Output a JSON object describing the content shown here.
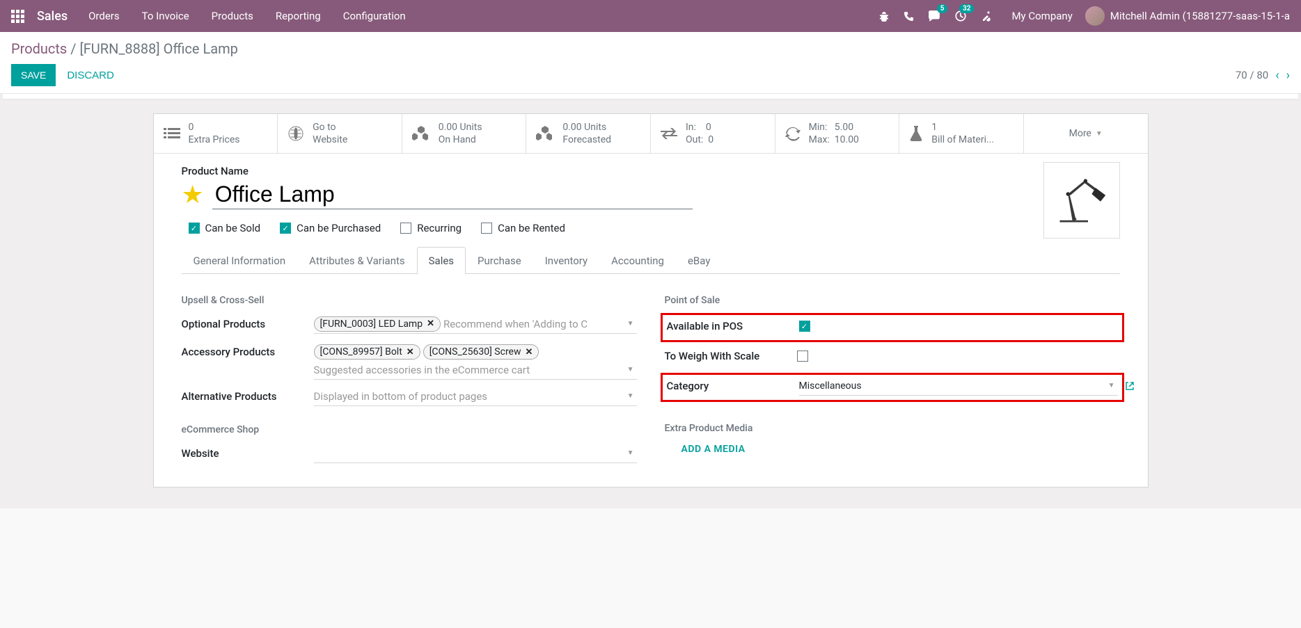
{
  "topbar": {
    "brand": "Sales",
    "nav": [
      "Orders",
      "To Invoice",
      "Products",
      "Reporting",
      "Configuration"
    ],
    "badge_chat": "5",
    "badge_clock": "32",
    "company": "My Company",
    "user": "Mitchell Admin (15881277-saas-15-1-a"
  },
  "breadcrumb": {
    "root": "Products",
    "current": "[FURN_8888] Office Lamp"
  },
  "actions": {
    "save": "SAVE",
    "discard": "DISCARD",
    "pager": "70 / 80"
  },
  "stats": {
    "extra_prices": {
      "value": "0",
      "label": "Extra Prices"
    },
    "website": {
      "line1": "Go to",
      "line2": "Website"
    },
    "on_hand": {
      "value": "0.00 Units",
      "label": "On Hand"
    },
    "forecasted": {
      "value": "0.00 Units",
      "label": "Forecasted"
    },
    "inout": {
      "in_label": "In:",
      "in_val": "0",
      "out_label": "Out:",
      "out_val": "0"
    },
    "minmax": {
      "min_label": "Min:",
      "min_val": "5.00",
      "max_label": "Max:",
      "max_val": "10.00"
    },
    "bom": {
      "value": "1",
      "label": "Bill of Materi..."
    },
    "more": "More"
  },
  "product": {
    "name_label": "Product Name",
    "name": "Office Lamp"
  },
  "checks": {
    "sold": "Can be Sold",
    "purchased": "Can be Purchased",
    "recurring": "Recurring",
    "rented": "Can be Rented"
  },
  "tabs": [
    "General Information",
    "Attributes & Variants",
    "Sales",
    "Purchase",
    "Inventory",
    "Accounting",
    "eBay"
  ],
  "form": {
    "upsell_heading": "Upsell & Cross-Sell",
    "optional_label": "Optional Products",
    "optional_tag": "[FURN_0003] LED Lamp",
    "optional_placeholder": "Recommend when 'Adding to C",
    "accessory_label": "Accessory Products",
    "accessory_tag1": "[CONS_89957] Bolt",
    "accessory_tag2": "[CONS_25630] Screw",
    "accessory_placeholder": "Suggested accessories in the eCommerce cart",
    "alternative_label": "Alternative Products",
    "alternative_placeholder": "Displayed in bottom of product pages",
    "ecommerce_heading": "eCommerce Shop",
    "website_label": "Website",
    "pos_heading": "Point of Sale",
    "available_pos_label": "Available in POS",
    "weigh_label": "To Weigh With Scale",
    "category_label": "Category",
    "category_value": "Miscellaneous",
    "extra_media_heading": "Extra Product Media",
    "add_media": "ADD A MEDIA"
  }
}
